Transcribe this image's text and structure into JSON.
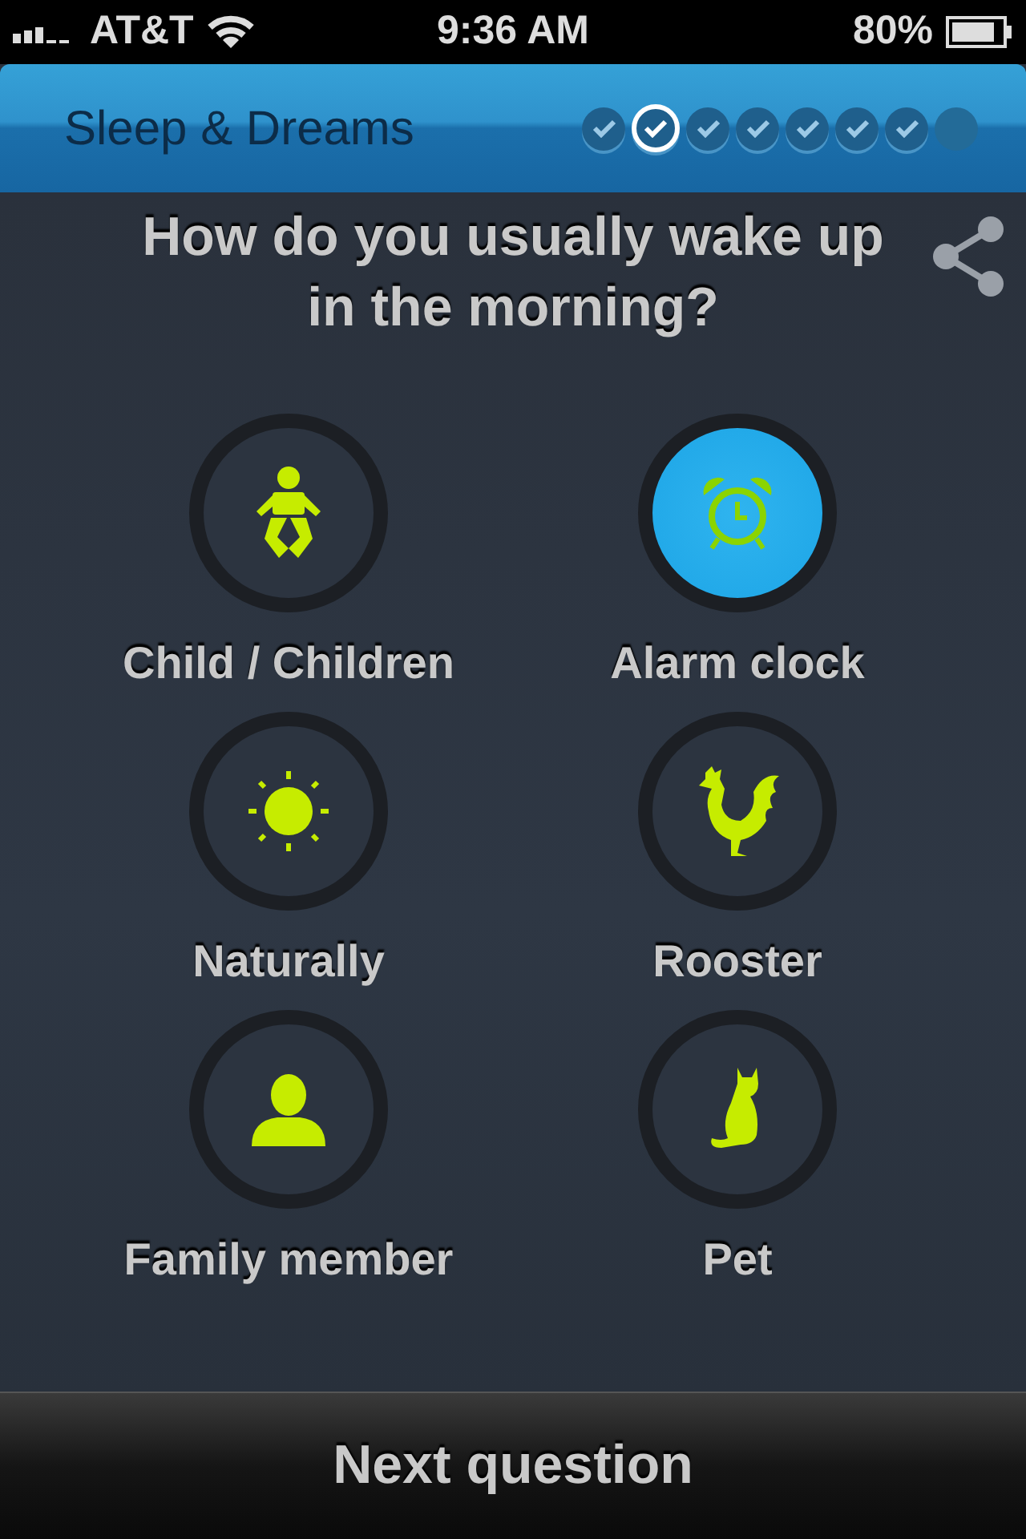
{
  "status_bar": {
    "carrier": "AT&T",
    "time": "9:36 AM",
    "battery": "80%"
  },
  "header": {
    "title": "Sleep & Dreams",
    "steps": [
      {
        "done": true,
        "selected": false
      },
      {
        "done": true,
        "selected": true
      },
      {
        "done": true,
        "selected": false
      },
      {
        "done": true,
        "selected": false
      },
      {
        "done": true,
        "selected": false
      },
      {
        "done": true,
        "selected": false
      },
      {
        "done": true,
        "selected": false
      },
      {
        "done": false,
        "selected": false
      }
    ]
  },
  "question": "How do you usually wake up in the morning?",
  "options": [
    {
      "label": "Child / Children",
      "kind": "baby",
      "selected": false
    },
    {
      "label": "Alarm clock",
      "kind": "alarm",
      "selected": true
    },
    {
      "label": "Naturally",
      "kind": "sun",
      "selected": false
    },
    {
      "label": "Rooster",
      "kind": "rooster",
      "selected": false
    },
    {
      "label": "Family member",
      "kind": "person",
      "selected": false
    },
    {
      "label": "Pet",
      "kind": "cat",
      "selected": false
    }
  ],
  "footer": {
    "button": "Next question"
  }
}
